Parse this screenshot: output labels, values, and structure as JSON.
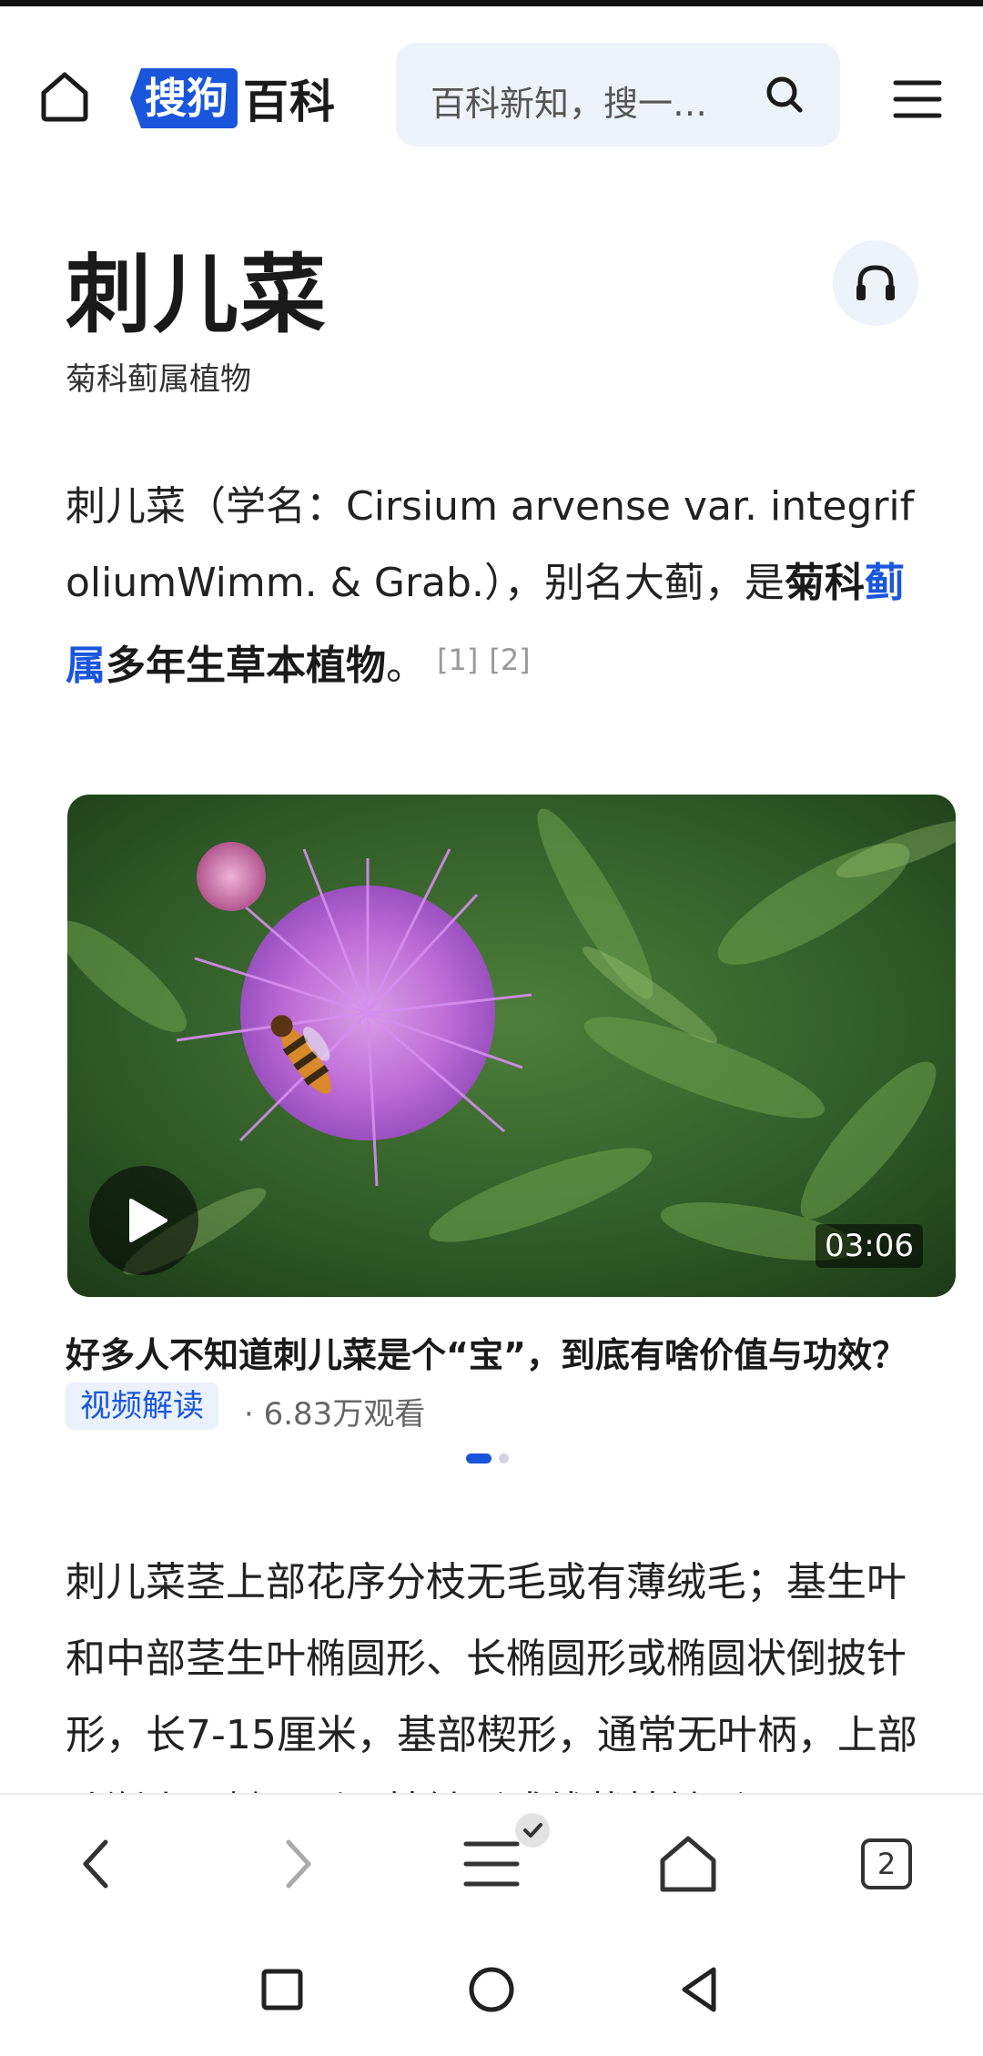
{
  "header": {
    "logo_part1": "搜狗",
    "logo_part2": "百科",
    "search_placeholder": "百科新知，搜一…"
  },
  "entry": {
    "title": "刺儿菜",
    "subtitle": "菊科蓟属植物",
    "intro_prefix": "刺儿菜（学名：Cirsium arvense var. integrifoliumWimm. & Grab.），别名大蓟，是",
    "intro_bold1": "菊科",
    "intro_link": "蓟属",
    "intro_bold2": "多年生草本植物",
    "intro_end": "。",
    "ref1": "[1]",
    "ref2": "[2]"
  },
  "video": {
    "duration": "03:06",
    "title": "好多人不知道刺儿菜是个“宝”，到底有啥价值与功效？",
    "tag": "视频解读",
    "views": "· 6.83万观看"
  },
  "carousel": {
    "active_index": 0,
    "total": 2
  },
  "body": {
    "paragraph": "刺儿菜茎上部花序分枝无毛或有薄绒毛；基生叶和中部茎生叶椭圆形、长椭圆形或椭圆状倒披针形，长7-15厘米，基部楔形，通常无叶柄，上部叶渐小，椭圆形、披针形或线状披针形"
  },
  "toolbar": {
    "tab_count": "2"
  },
  "icons": {
    "home": "home-icon",
    "search": "search-icon",
    "menu": "hamburger-menu-icon",
    "audio": "headphones-icon",
    "play": "play-icon",
    "back": "chevron-left-icon",
    "forward": "chevron-right-icon",
    "list_menu": "list-menu-icon",
    "browser_home": "home-icon",
    "tabs": "tabs-icon"
  },
  "colors": {
    "brand_blue": "#1a56db",
    "search_bg": "#eef2f9",
    "text": "#222222"
  }
}
